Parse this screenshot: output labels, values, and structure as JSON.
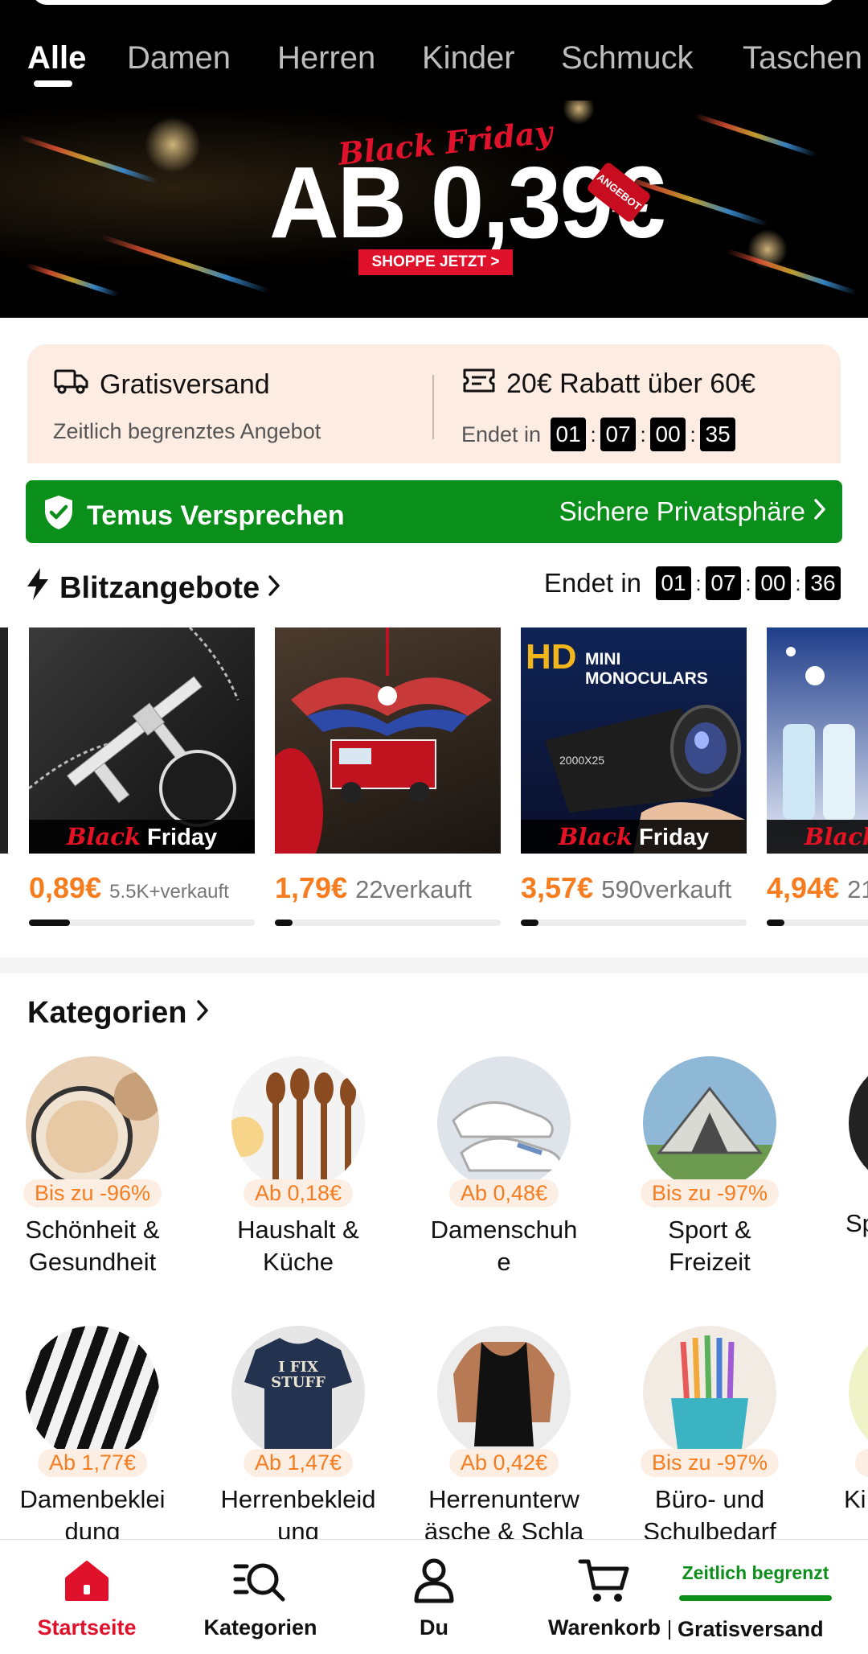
{
  "tabs": [
    "Alle",
    "Damen",
    "Herren",
    "Kinder",
    "Schmuck",
    "Taschen"
  ],
  "banner": {
    "script": "Black Friday",
    "headline": "AB 0,39€",
    "tag": "ANGEBOT",
    "cta": "SHOPPE JETZT >"
  },
  "promo": {
    "shipping_title": "Gratisversand",
    "shipping_sub": "Zeitlich begrenztes Angebot",
    "discount_title": "20€ Rabatt über 60€",
    "ends_label": "Endet in",
    "timer": [
      "01",
      "07",
      "00",
      "35"
    ]
  },
  "promise": {
    "title": "Temus Versprechen",
    "link": "Sichere Privatsphäre"
  },
  "flash": {
    "title": "Blitzangebote",
    "ends_label": "Endet in",
    "timer": [
      "01",
      "07",
      "00",
      "36"
    ],
    "strip_black": "Black",
    "strip_friday": "Friday",
    "products": [
      {
        "price": "0,89€",
        "sold": "5.5K+verkauft",
        "progress": 0.18
      },
      {
        "price": "1,79€",
        "sold": "22verkauft",
        "progress": 0.08
      },
      {
        "price": "3,57€",
        "sold": "590verkauft",
        "progress": 0.08
      },
      {
        "price": "4,94€",
        "sold": "21",
        "progress": 0.08
      }
    ],
    "monocular_header": "MINI MONOCULARS",
    "monocular_hd": "HD",
    "monocular_spec": "2000X25"
  },
  "categories": {
    "title": "Kategorien",
    "items": [
      {
        "badge": "Bis zu -96%",
        "label1": "Schönheit &",
        "label2": "Gesundheit"
      },
      {
        "badge": "Ab 0,18€",
        "label1": "Haushalt &",
        "label2": "Küche"
      },
      {
        "badge": "Ab 0,48€",
        "label1": "Damenschuh",
        "label2": "e"
      },
      {
        "badge": "Bis zu -97%",
        "label1": "Sport &",
        "label2": "Freizeit"
      },
      {
        "badge": "",
        "label1": "Sp",
        "label2": ""
      },
      {
        "badge": "Ab 1,77€",
        "label1": "Damenbeklei",
        "label2": "dung"
      },
      {
        "badge": "Ab 1,47€",
        "label1": "Herrenbekleid",
        "label2": "ung"
      },
      {
        "badge": "Ab 0,42€",
        "label1": "Herrenunterw",
        "label2": "äsche & Schla"
      },
      {
        "badge": "Bis zu -97%",
        "label1": "Büro- und",
        "label2": "Schulbedarf"
      },
      {
        "badge": "B",
        "label1": "Ki",
        "label2": ""
      }
    ],
    "tshirt_text": "I FIX STUFF"
  },
  "nav": {
    "home": "Startseite",
    "categories": "Kategorien",
    "you": "Du",
    "cart": "Warenkorb",
    "promo_text": "Zeitlich begrenzt",
    "shipping": "Gratisversand"
  },
  "colors": {
    "accent_orange": "#f57d1f",
    "brand_red": "#e0122b",
    "promise_green": "#0a8f1a"
  }
}
